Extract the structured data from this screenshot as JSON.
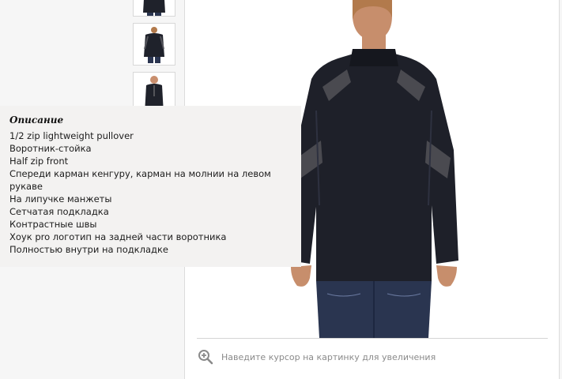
{
  "description": {
    "title": "Описание",
    "items": [
      "1/2 zip lightweight pullover",
      "Воротник-стойка",
      "Half zip front",
      "Спереди карман кенгуру, карман на молнии на левом рукаве",
      "На липучке манжеты",
      "Сетчатая подкладка",
      "Контрастные швы",
      "Хоук pro логотип на задней части воротника",
      "Полностью внутри на подкладке"
    ]
  },
  "zoom": {
    "hint": "Наведите курсор на картинку для увеличения",
    "icon": "zoom-in-icon"
  },
  "colors": {
    "jacket": "#1e2029",
    "accent_panel": "#4a4a50",
    "jeans": "#2a3550",
    "skin": "#d9a383",
    "hair": "#b27a4c"
  }
}
